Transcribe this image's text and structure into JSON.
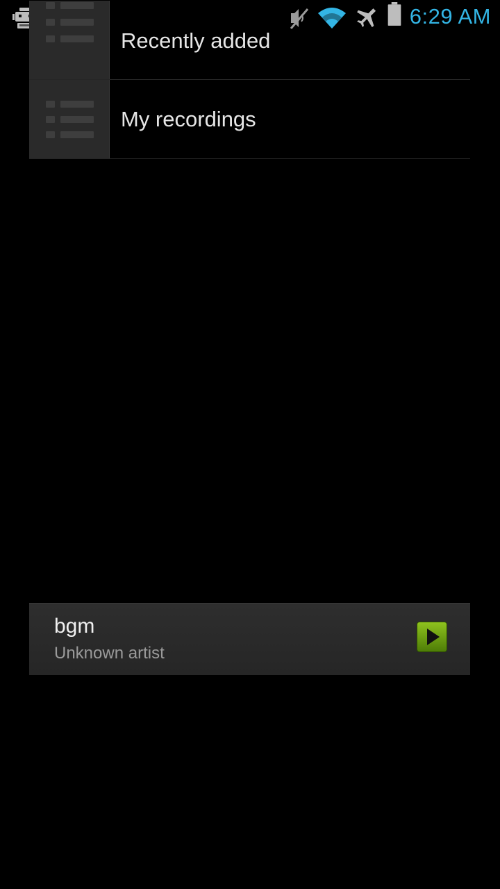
{
  "status_bar": {
    "time": "6:29 AM",
    "icons": [
      "robot-notification-icon",
      "android-notification-icon",
      "mute-icon",
      "wifi-icon",
      "airplane-mode-icon",
      "battery-icon"
    ],
    "time_color": "#33b5e5"
  },
  "playlists": {
    "items": [
      {
        "label": "Recently added",
        "icon": "playlist-icon"
      },
      {
        "label": "My recordings",
        "icon": "playlist-icon"
      }
    ]
  },
  "now_playing": {
    "title": "bgm",
    "artist": "Unknown artist",
    "action_icon": "play-icon",
    "accent": "#76a814"
  }
}
